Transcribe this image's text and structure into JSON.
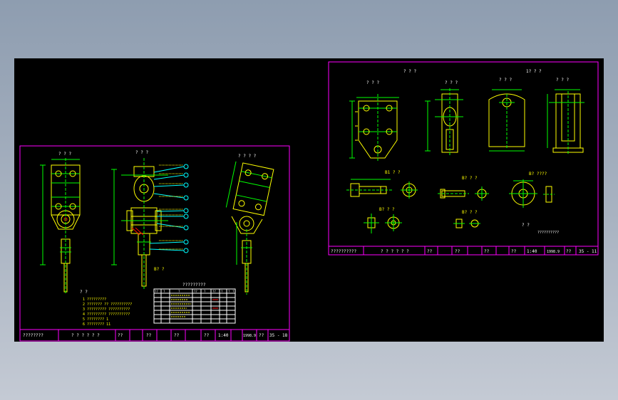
{
  "colors": {
    "background": "#000000",
    "frame": "#ff00ff",
    "part": "#ffff00",
    "dimension": "#00ff00",
    "callout": "#00ffff",
    "hatch": "#ff0000",
    "text": "#ffffff"
  },
  "sheet_left": {
    "view_titles": [
      "? ? ?",
      "? ? ?",
      "? ? ? ?"
    ],
    "sub_label": "B? ?",
    "bom_title": "?????????",
    "bom_headers": [
      "??",
      "?",
      "?",
      "??",
      "?",
      "??",
      "?",
      "?",
      "?"
    ],
    "notes_title": "? ?",
    "notes": [
      "1 ?????????",
      "2 ??????? ?? ??????????",
      "3 ????????? ??????????",
      "4 ????????? ??????????",
      "5 ???????? 1",
      "6 ???????? 11"
    ],
    "title_block": [
      "????????",
      "? ? ? ? ? ?",
      "??",
      "??",
      "??",
      "??",
      "1:40",
      "1998.9",
      "??",
      "35 - 18"
    ]
  },
  "sheet_right": {
    "view_titles": [
      "? ? ?",
      "? ? ?",
      "? ? ?",
      "? ? ?",
      "1? ? ?"
    ],
    "detail_labels": [
      "B1 ? ?",
      "B? ? ?",
      "B? ????",
      "B? ? ?",
      "B? ? ?"
    ],
    "note_mark": "? ?",
    "note_text": "??????????",
    "title_block": [
      "??????????",
      "? ? ? ? ? ?",
      "??",
      "??",
      "??",
      "??",
      "1:40",
      "1998.9",
      "??",
      "35 - 11"
    ]
  }
}
